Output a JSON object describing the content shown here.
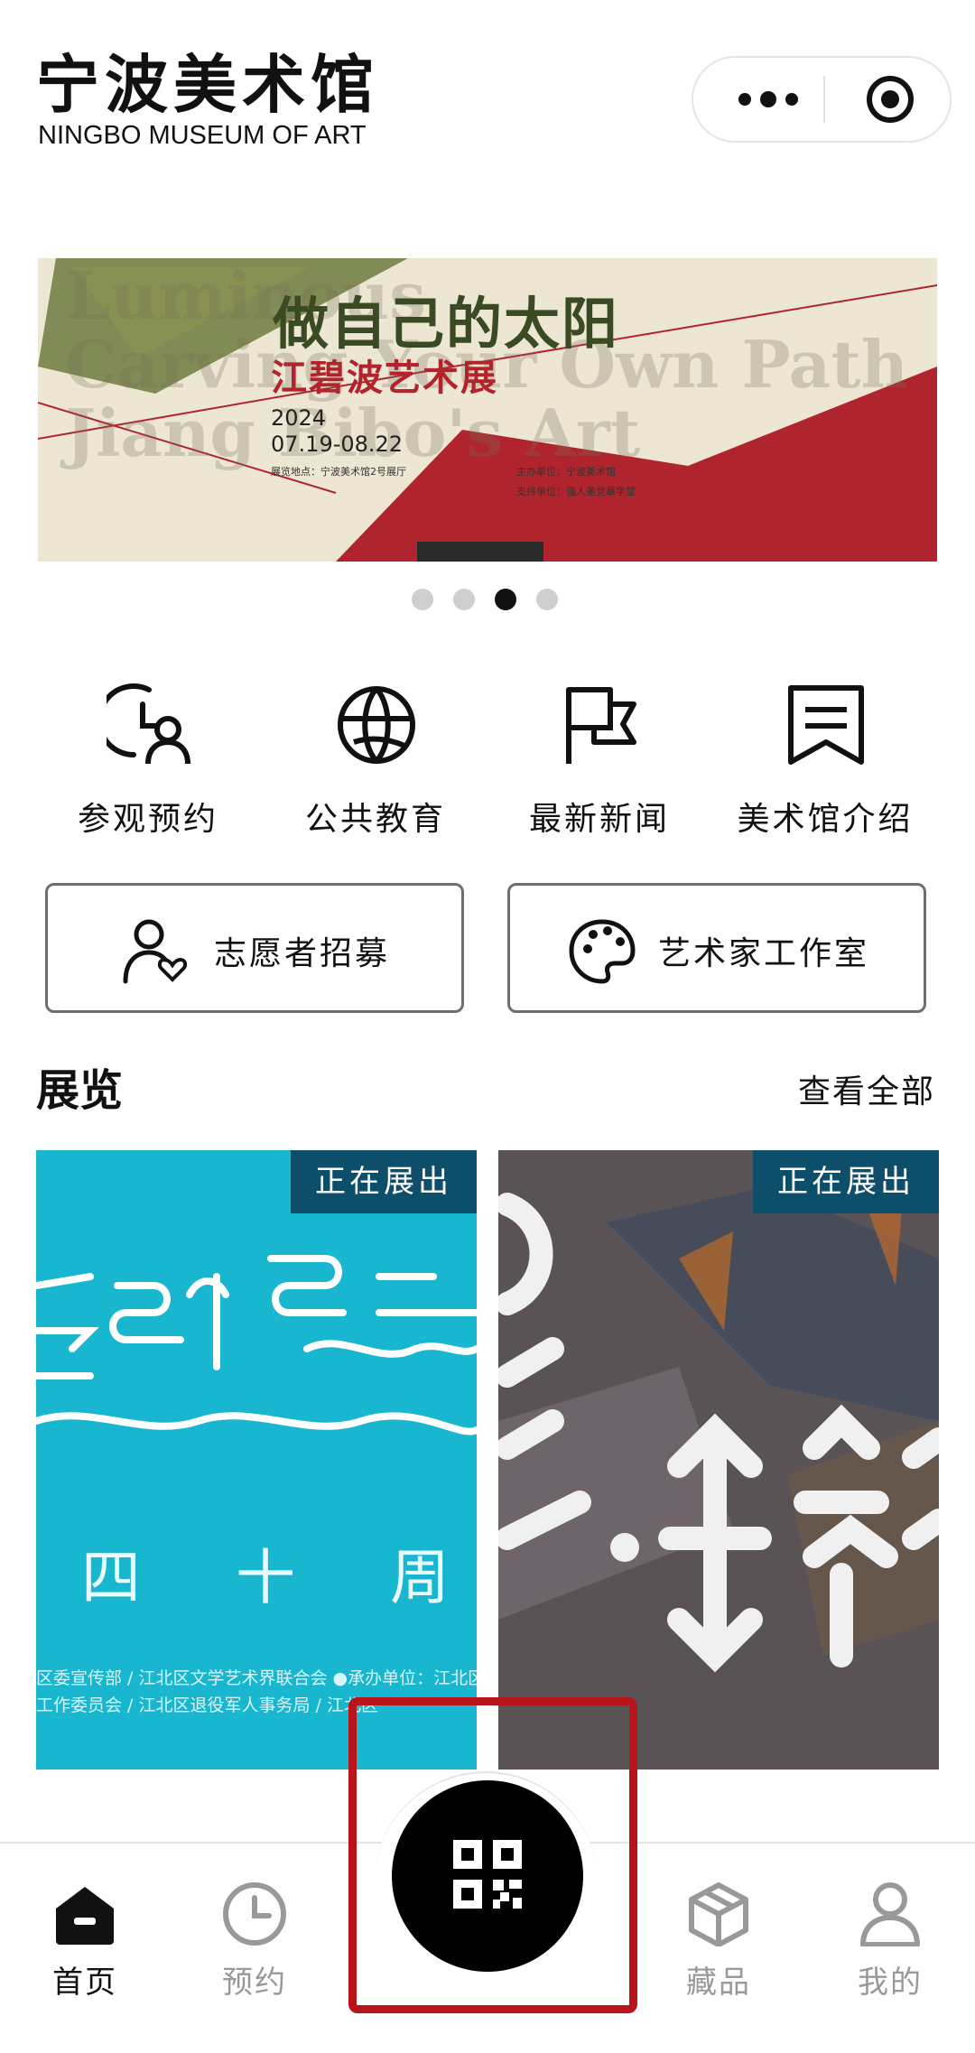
{
  "header": {
    "title_cn": "宁波美术馆",
    "title_en": "NINGBO MUSEUM OF ART"
  },
  "banner": {
    "ghost_lines": [
      "Luminous",
      "Carving Your Own Path",
      "Jiang Bibo's Art"
    ],
    "title_cn": "做自己的太阳",
    "subtitle_cn": "江碧波艺术展",
    "year": "2024",
    "dates": "07.19-08.22",
    "venue": "展览地点：宁波美术馆2号展厅",
    "organizer": "主办单位：宁波美术馆",
    "supporter": "支持单位：强人墨党摹学堂",
    "active_index": 2,
    "total": 4
  },
  "quick_nav": [
    {
      "icon": "clock-person-icon",
      "label": "参观预约"
    },
    {
      "icon": "globe-icon",
      "label": "公共教育"
    },
    {
      "icon": "flag-icon",
      "label": "最新新闻"
    },
    {
      "icon": "bookmark-icon",
      "label": "美术馆介绍"
    }
  ],
  "big_buttons": [
    {
      "icon": "volunteer-heart-icon",
      "label": "志愿者招募"
    },
    {
      "icon": "palette-icon",
      "label": "艺术家工作室"
    }
  ],
  "exhibitions": {
    "title": "展览",
    "view_all": "查看全部",
    "cards": [
      {
        "badge": "正在展出",
        "years_text": "四 十 周 年",
        "credit_line1": "区委宣传部 / 江北区文学艺术界联合会 ●承办单位：江北区",
        "credit_line2": "工作委员会 / 江北区退役军人事务局 / 江北区",
        "color": "#19b6cf"
      },
      {
        "badge": "正在展出",
        "color": "#5b5458"
      }
    ]
  },
  "tabbar": {
    "tabs": [
      {
        "icon": "home-icon",
        "label": "首页",
        "active": true
      },
      {
        "icon": "clock-icon",
        "label": "预约",
        "active": false
      },
      {
        "icon": "qr-code-icon",
        "label": "",
        "active": false
      },
      {
        "icon": "cube-icon",
        "label": "藏品",
        "active": false
      },
      {
        "icon": "user-icon",
        "label": "我的",
        "active": false
      }
    ]
  },
  "colors": {
    "accent": "#000000",
    "badge": "#0d4e6a",
    "highlight_box": "#b8141a"
  }
}
